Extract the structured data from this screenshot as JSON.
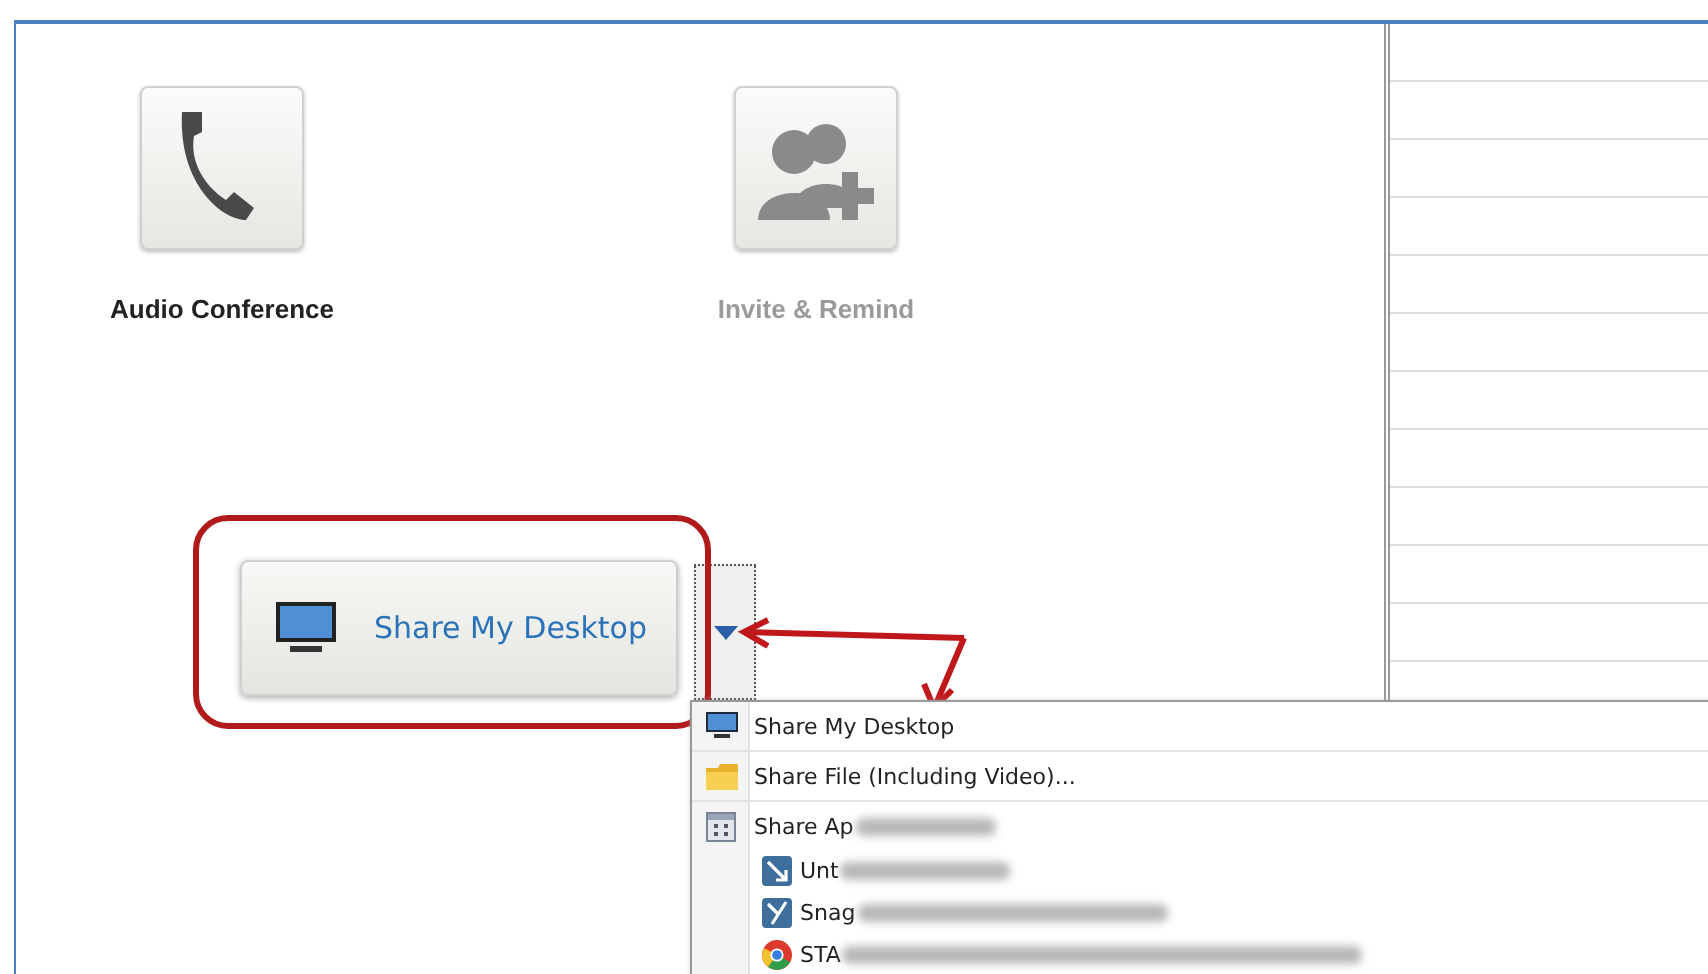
{
  "actions": [
    {
      "kind": "phone",
      "label": "Audio Conference",
      "disabled": false
    },
    {
      "kind": "people",
      "label": "Invite & Remind",
      "disabled": true
    }
  ],
  "share_button": {
    "label": "Share My Desktop"
  },
  "dropdown": {
    "expanded": true
  },
  "menu": {
    "items": [
      {
        "kind": "monitor",
        "label": "Share My Desktop",
        "separator_after": true,
        "blurred": false
      },
      {
        "kind": "folder",
        "label": "Share File (Including Video)...",
        "separator_after": true,
        "blurred": false
      },
      {
        "kind": "application",
        "label": "Share Ap",
        "separator_after": false,
        "blurred": true,
        "children": [
          {
            "kind": "remote",
            "label": "Unt",
            "blurred": true
          },
          {
            "kind": "snag",
            "label": "Snag",
            "blurred": true
          },
          {
            "kind": "browser",
            "label": "STA",
            "blurred": true
          }
        ]
      }
    ]
  }
}
